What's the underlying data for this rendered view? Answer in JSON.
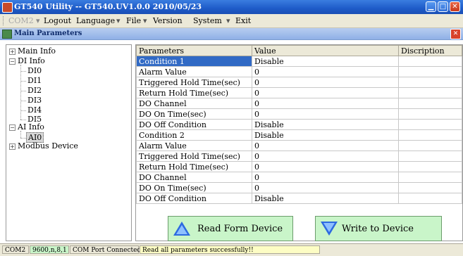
{
  "window": {
    "title": "GT540 Utility -- GT540.UV1.0.0 2010/05/23"
  },
  "menu": {
    "com_port": "COM2",
    "items": [
      "Logout",
      "Language",
      "File",
      "Version",
      "System",
      "Exit"
    ]
  },
  "panel": {
    "title": "Main Parameters"
  },
  "tree": {
    "main_info": "Main Info",
    "di_info": "DI Info",
    "di_children": [
      "DI0",
      "DI1",
      "DI2",
      "DI3",
      "DI4",
      "DI5"
    ],
    "ai_info": "AI Info",
    "ai_children": [
      "AI0"
    ],
    "modbus": "Modbus Device"
  },
  "grid": {
    "columns": [
      "Parameters",
      "Value",
      "Discription"
    ],
    "rows": [
      [
        "Condition 1",
        "Disable",
        ""
      ],
      [
        "Alarm Value",
        "0",
        ""
      ],
      [
        "Triggered Hold Time(sec)",
        "0",
        ""
      ],
      [
        "Return Hold Time(sec)",
        "0",
        ""
      ],
      [
        "DO Channel",
        "0",
        ""
      ],
      [
        "DO On Time(sec)",
        "0",
        ""
      ],
      [
        "DO Off Condition",
        "Disable",
        ""
      ],
      [
        "Condition 2",
        "Disable",
        ""
      ],
      [
        "Alarm Value",
        "0",
        ""
      ],
      [
        "Triggered Hold Time(sec)",
        "0",
        ""
      ],
      [
        "Return Hold Time(sec)",
        "0",
        ""
      ],
      [
        "DO Channel",
        "0",
        ""
      ],
      [
        "DO On Time(sec)",
        "0",
        ""
      ],
      [
        "DO Off Condition",
        "Disable",
        ""
      ]
    ]
  },
  "buttons": {
    "read": "Read Form Device",
    "write": "Write to Device"
  },
  "status": {
    "port": "COM2",
    "settings": "9600,n,8,1",
    "connection": "COM Port Connected",
    "message": "Read all parameters successfully!!"
  },
  "colors": {
    "selection": "#316ac5",
    "button_bg": "#c9f5c9",
    "titlebar": "#1e5bc8"
  }
}
